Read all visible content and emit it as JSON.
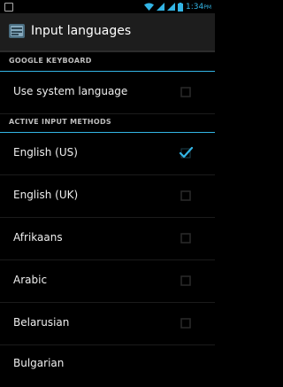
{
  "status_bar": {
    "time": "1:34",
    "ampm": "PM",
    "icons": [
      "image-notification-icon",
      "wifi-icon",
      "signal-icon",
      "signal-icon-2",
      "battery-icon"
    ]
  },
  "action_bar": {
    "title": "Input languages",
    "icon": "keyboard-settings-icon"
  },
  "sections": [
    {
      "header": "GOOGLE KEYBOARD"
    },
    {
      "header": "ACTIVE INPUT METHODS"
    }
  ],
  "rows": {
    "system": {
      "label": "Use system language",
      "checked": false
    },
    "languages": [
      {
        "label": "English (US)",
        "checked": true
      },
      {
        "label": "English (UK)",
        "checked": false
      },
      {
        "label": "Afrikaans",
        "checked": false
      },
      {
        "label": "Arabic",
        "checked": false
      },
      {
        "label": "Belarusian",
        "checked": false
      },
      {
        "label": "Bulgarian",
        "checked": false
      }
    ]
  },
  "colors": {
    "accent": "#33b5e5",
    "check": "#33b5e5",
    "background": "#000000"
  }
}
